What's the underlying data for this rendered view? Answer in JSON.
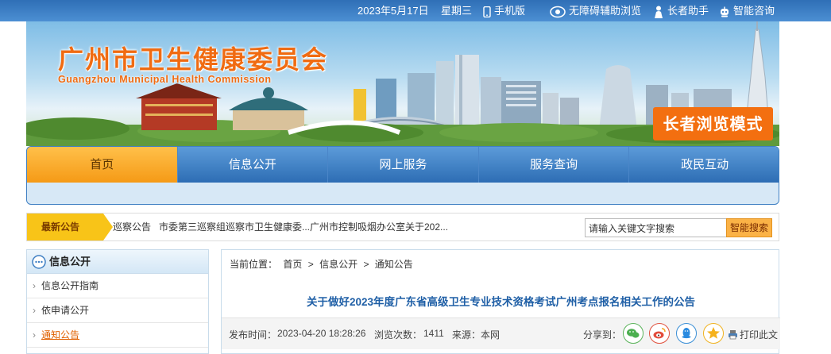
{
  "topbar": {
    "date": "2023年5月17日",
    "weekday": "星期三",
    "mobile": "手机版",
    "accessible": "无障碍辅助浏览",
    "elder_helper": "长者助手",
    "smart_consult": "智能咨询"
  },
  "banner": {
    "title_cn": "广州市卫生健康委员会",
    "title_en": "Guangzhou Municipal Health Commission",
    "elder_mode": "长者浏览模式"
  },
  "nav": {
    "items": [
      "首页",
      "信息公开",
      "网上服务",
      "服务查询",
      "政民互动"
    ],
    "active_index": 0
  },
  "notice": {
    "tag": "最新公告",
    "items": [
      "巡察公告",
      "市委第三巡察组巡察市卫生健康委...",
      "广州市控制吸烟办公室关于202..."
    ],
    "search_placeholder": "请输入关键文字搜索",
    "search_button": "智能搜索"
  },
  "sidebar": {
    "title": "信息公开",
    "items": [
      "信息公开指南",
      "依申请公开",
      "通知公告"
    ],
    "active_index": 2
  },
  "content": {
    "breadcrumb_label": "当前位置：",
    "breadcrumb": [
      "首页",
      ">",
      "信息公开",
      ">",
      "通知公告"
    ],
    "title": "关于做好2023年度广东省高级卫生专业技术资格考试广州考点报名相关工作的公告",
    "meta": {
      "publish_label": "发布时间：",
      "publish_time": "2023-04-20 18:28:26",
      "views_label": "浏览次数：",
      "views": "1411",
      "source_label": "来源：",
      "source": "本网"
    },
    "share_label": "分享到：",
    "share_icons": [
      "wechat-icon",
      "weibo-icon",
      "qq-icon",
      "qzone-icon"
    ],
    "print_label": "打印此文"
  },
  "colors": {
    "brand_blue": "#2d6db4",
    "accent_orange": "#f36f10",
    "active_nav": "#f59a16",
    "title_blue": "#1f5fa6"
  }
}
